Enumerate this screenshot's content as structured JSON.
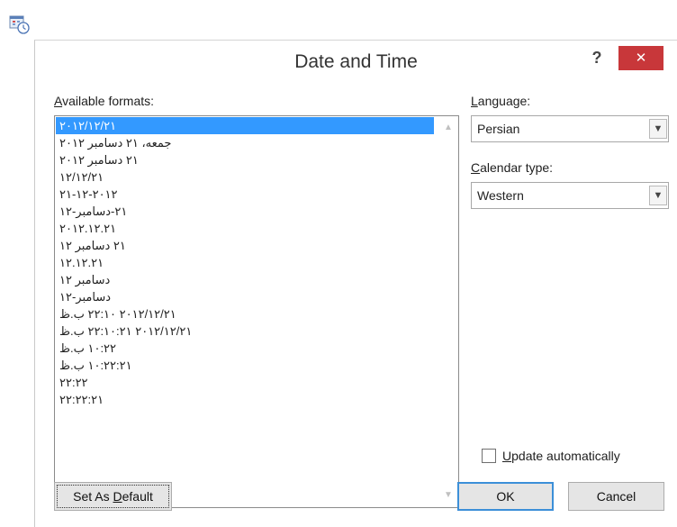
{
  "dialog": {
    "title": "Date and Time",
    "help_label": "?",
    "close_label": "✕"
  },
  "formats": {
    "label_mnemonic": "A",
    "label_rest": "vailable formats:",
    "items": [
      "۲۰۱۲/۱۲/۲۱",
      "جمعه، ۲۱ دسامبر ۲۰۱۲",
      "۲۱ دسامبر ۲۰۱۲",
      "۱۲/۱۲/۲۱",
      "۲۱-۱۲-۲۰۱۲",
      "۲۱-دسامبر-۱۲",
      "۲۰۱۲.۱۲.۲۱",
      "۲۱ دسامبر ۱۲",
      "۱۲.۱۲.۲۱",
      "دسامبر ۱۲",
      "دسامبر-۱۲",
      "۲۰۱۲/۱۲/۲۱ ۲۲:۱۰ ب.ظ",
      "۲۰۱۲/۱۲/۲۱ ۲۲:۱۰:۲۱ ب.ظ",
      "۱۰:۲۲ ب.ظ",
      "۱۰:۲۲:۲۱ ب.ظ",
      "۲۲:۲۲",
      "۲۲:۲۲:۲۱"
    ],
    "selected_index": 0
  },
  "language": {
    "label_mnemonic": "L",
    "label_rest": "anguage:",
    "value": "Persian"
  },
  "calendar": {
    "label_mnemonic": "C",
    "label_rest": "alendar type:",
    "value": "Western"
  },
  "update": {
    "label_mnemonic": "U",
    "label_rest": "pdate automatically",
    "checked": false
  },
  "buttons": {
    "set_default_prefix": "Set As ",
    "set_default_mnemonic": "D",
    "set_default_suffix": "efault",
    "ok": "OK",
    "cancel": "Cancel"
  },
  "icons": {
    "ribbon": "date-time-icon",
    "scroll_up": "scroll-up-arrow-icon",
    "scroll_down": "scroll-down-arrow-icon",
    "dropdown": "chevron-down-icon"
  },
  "colors": {
    "selection": "#3399ff",
    "close_button": "#c8373a",
    "ok_border": "#3c8fd8"
  }
}
